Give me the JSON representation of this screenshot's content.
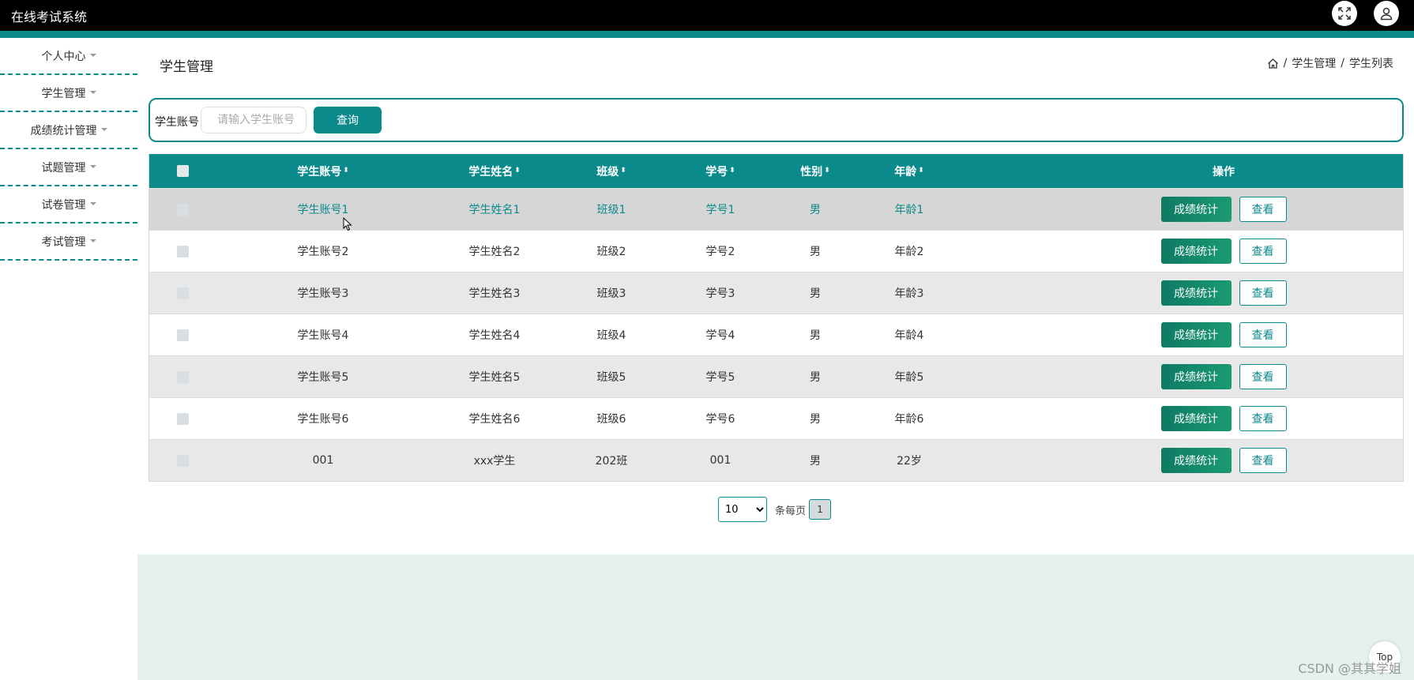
{
  "app": {
    "title": "在线考试系统"
  },
  "header_icons": [
    "fullscreen-icon",
    "user-icon"
  ],
  "sidebar": {
    "items": [
      {
        "label": "个人中心"
      },
      {
        "label": "学生管理"
      },
      {
        "label": "成绩统计管理"
      },
      {
        "label": "试题管理"
      },
      {
        "label": "试卷管理"
      },
      {
        "label": "考试管理"
      }
    ]
  },
  "page": {
    "title": "学生管理"
  },
  "breadcrumb": {
    "sep": "/",
    "items": [
      "学生管理",
      "学生列表"
    ]
  },
  "search": {
    "label": "学生账号",
    "placeholder": "请输入学生账号",
    "button": "查询"
  },
  "table": {
    "headers": [
      "学生账号",
      "学生姓名",
      "班级",
      "学号",
      "性别",
      "年龄",
      "操作"
    ],
    "sort_icon": "⬍",
    "rows": [
      [
        "学生账号1",
        "学生姓名1",
        "班级1",
        "学号1",
        "男",
        "年龄1"
      ],
      [
        "学生账号2",
        "学生姓名2",
        "班级2",
        "学号2",
        "男",
        "年龄2"
      ],
      [
        "学生账号3",
        "学生姓名3",
        "班级3",
        "学号3",
        "男",
        "年龄3"
      ],
      [
        "学生账号4",
        "学生姓名4",
        "班级4",
        "学号4",
        "男",
        "年龄4"
      ],
      [
        "学生账号5",
        "学生姓名5",
        "班级5",
        "学号5",
        "男",
        "年龄5"
      ],
      [
        "学生账号6",
        "学生姓名6",
        "班级6",
        "学号6",
        "男",
        "年龄6"
      ],
      [
        "001",
        "xxx学生",
        "202班",
        "001",
        "男",
        "22岁"
      ]
    ],
    "actions": {
      "stat": "成绩统计",
      "view": "查看"
    }
  },
  "pagination": {
    "page_size": "10",
    "page_size_options": [
      "10"
    ],
    "per_page_label": "条每页",
    "current_page": "1"
  },
  "back_to_top": "Top",
  "watermark": "CSDN @其其学姐",
  "colors": {
    "primary": "#0b8a8c",
    "topbar": "#000000",
    "button_green": "#0f7f6a",
    "band": "#e5f1ee"
  }
}
